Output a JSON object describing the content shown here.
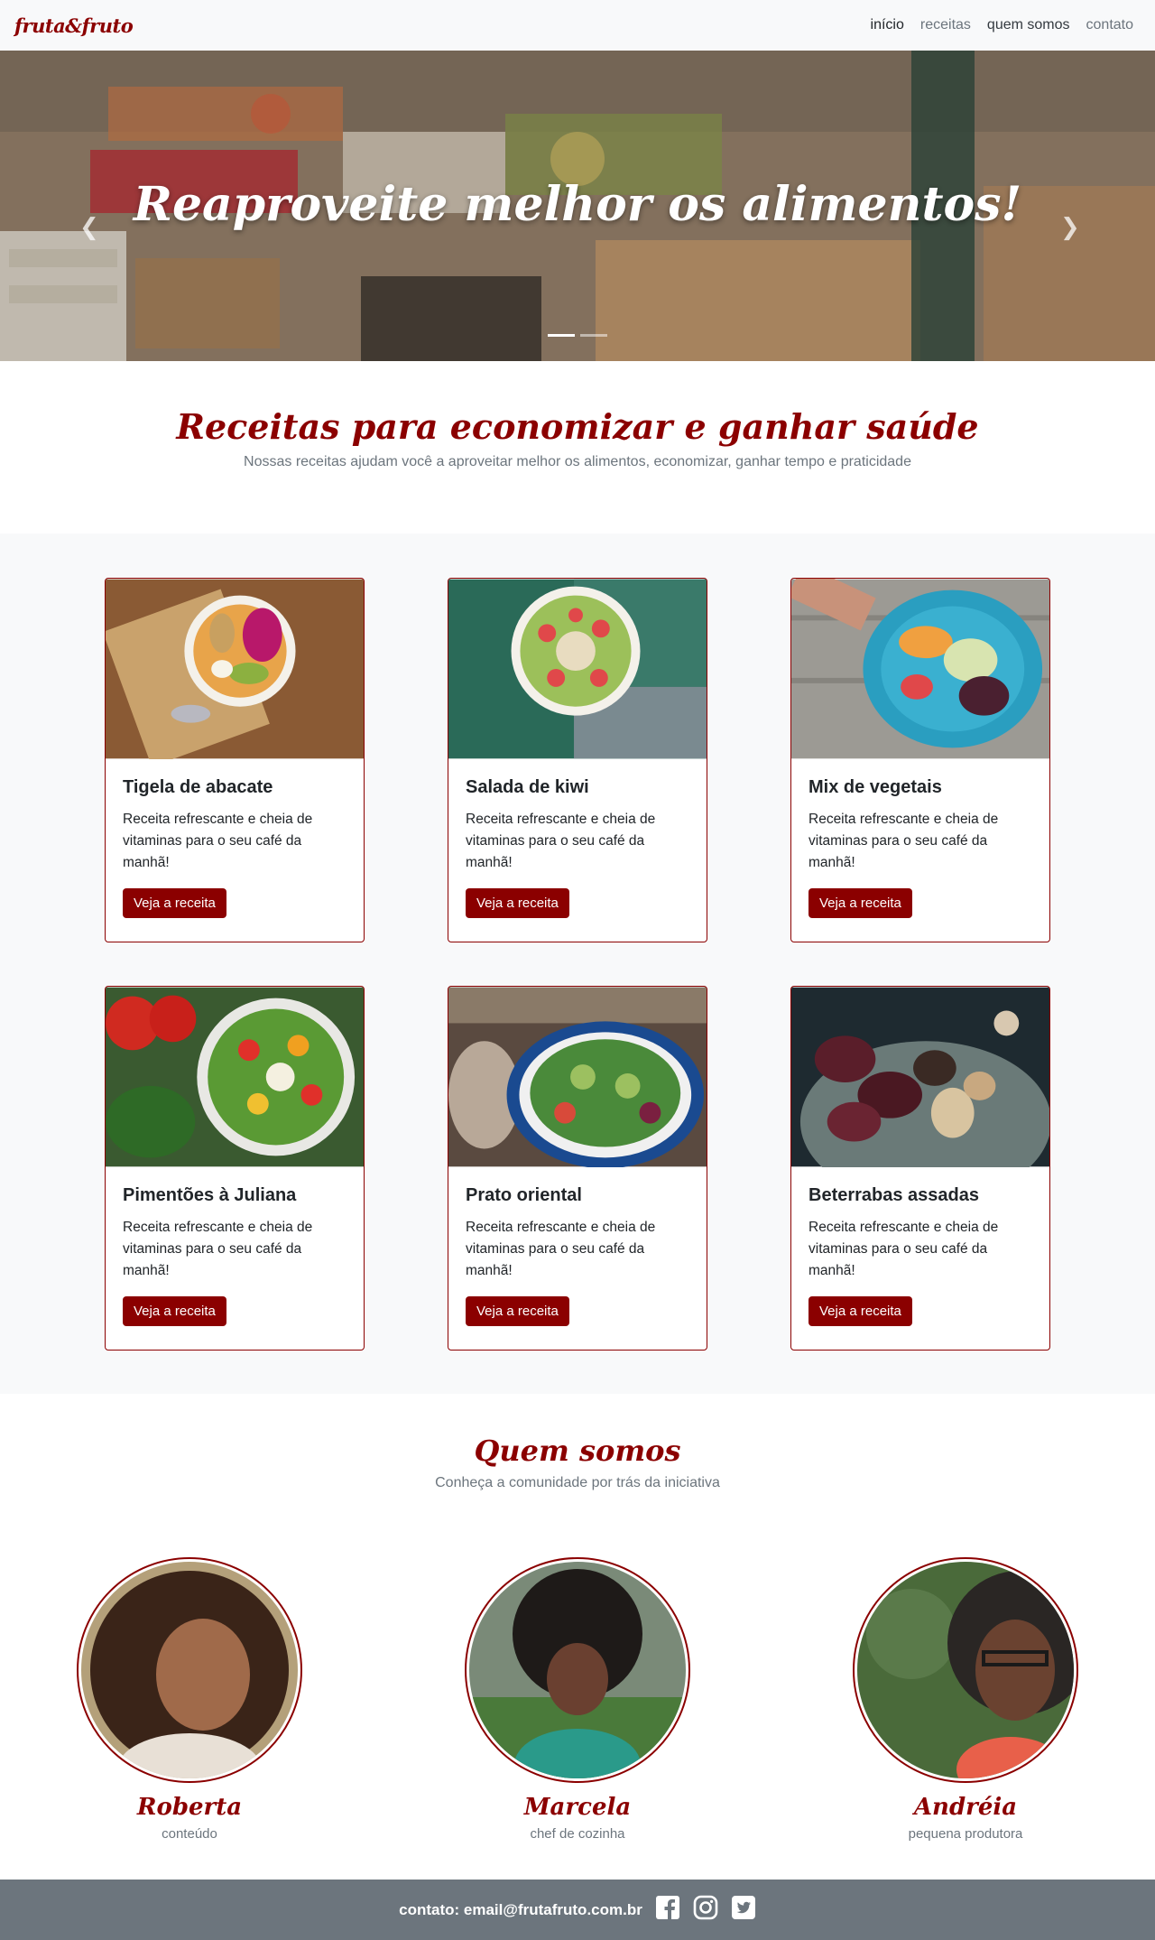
{
  "navbar": {
    "brand": "fruta&fruto",
    "links": [
      "início",
      "receitas",
      "quem somos",
      "contato"
    ]
  },
  "hero": {
    "title": "Reaproveite melhor os alimentos!",
    "prev_icon": "chevron-left-icon",
    "next_icon": "chevron-right-icon",
    "slides": 2,
    "active_slide": 1
  },
  "recipes_section": {
    "title": "Receitas para economizar e ganhar saúde",
    "subtitle": "Nossas receitas ajudam você a aproveitar melhor os alimentos, economizar, ganhar tempo e praticidade"
  },
  "recipes": [
    {
      "title": "Tigela de abacate",
      "text": "Receita refrescante e cheia de vitaminas para o seu café da manhã!",
      "button": "Veja a receita"
    },
    {
      "title": "Salada de kiwi",
      "text": "Receita refrescante e cheia de vitaminas para o seu café da manhã!",
      "button": "Veja a receita"
    },
    {
      "title": "Mix de vegetais",
      "text": "Receita refrescante e cheia de vitaminas para o seu café da manhã!",
      "button": "Veja a receita"
    },
    {
      "title": "Pimentões à Juliana",
      "text": "Receita refrescante e cheia de vitaminas para o seu café da manhã!",
      "button": "Veja a receita"
    },
    {
      "title": "Prato oriental",
      "text": "Receita refrescante e cheia de vitaminas para o seu café da manhã!",
      "button": "Veja a receita"
    },
    {
      "title": "Beterrabas assadas",
      "text": "Receita refrescante e cheia de vitaminas para o seu café da manhã!",
      "button": "Veja a receita"
    }
  ],
  "team_section": {
    "title": "Quem somos",
    "subtitle": "Conheça a comunidade por trás da iniciativa"
  },
  "team": [
    {
      "name": "Roberta",
      "role": "conteúdo"
    },
    {
      "name": "Marcela",
      "role": "chef de cozinha"
    },
    {
      "name": "Andréia",
      "role": "pequena produtora"
    }
  ],
  "footer": {
    "contact": "contato: email@frutafruto.com.br",
    "icons": [
      "facebook-icon",
      "instagram-icon",
      "twitter-icon"
    ]
  },
  "colors": {
    "accent": "#8b0000",
    "muted": "#6c757d",
    "light_bg": "#f8f9fa"
  }
}
